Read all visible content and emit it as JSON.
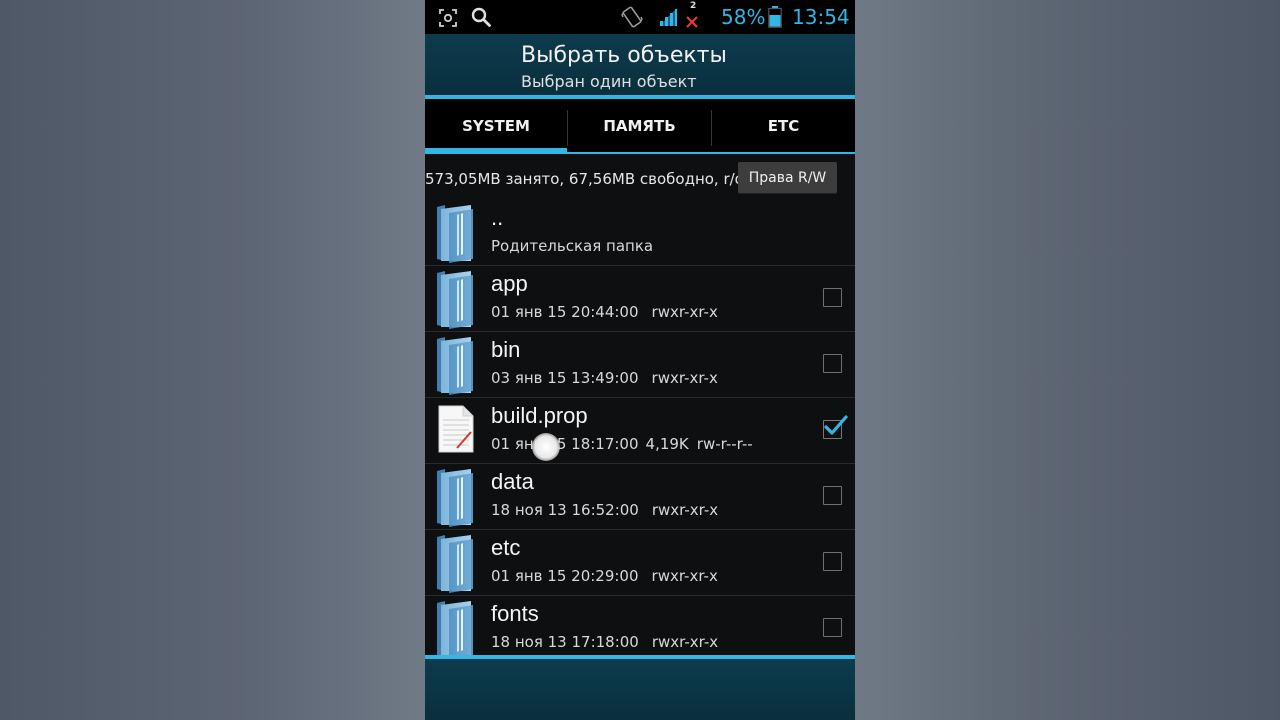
{
  "status_bar": {
    "battery": "58%",
    "time": "13:54",
    "sim_badge": "2",
    "icons": [
      "screenshot-icon",
      "search-icon",
      "vibrate-icon",
      "signal-icon",
      "no-signal-icon",
      "battery-icon"
    ],
    "accent_color": "#33b5e5"
  },
  "action_bar": {
    "title": "Выбрать объекты",
    "subtitle": "Выбран один объект"
  },
  "tabs": [
    {
      "label": "SYSTEM",
      "active": true
    },
    {
      "label": "ПАМЯТЬ",
      "active": false
    },
    {
      "label": "ETC",
      "active": false
    }
  ],
  "storage": {
    "info": "573,05MB занято, 67,56MB свободно, r/o",
    "rw_button": "Права R/W"
  },
  "files": [
    {
      "name": "..",
      "info": "Родительская папка",
      "type": "folder"
    },
    {
      "name": "app",
      "date": "01 янв 15 20:44:00",
      "size": "",
      "perms": "rwxr-xr-x",
      "type": "folder",
      "checked": false
    },
    {
      "name": "bin",
      "date": "03 янв 15 13:49:00",
      "size": "",
      "perms": "rwxr-xr-x",
      "type": "folder",
      "checked": false
    },
    {
      "name": "build.prop",
      "date": "01 янв 15 18:17:00",
      "size": "4,19K",
      "perms": "rw-r--r--",
      "type": "file",
      "checked": true
    },
    {
      "name": "data",
      "date": "18 ноя 13 16:52:00",
      "size": "",
      "perms": "rwxr-xr-x",
      "type": "folder",
      "checked": false
    },
    {
      "name": "etc",
      "date": "01 янв 15 20:29:00",
      "size": "",
      "perms": "rwxr-xr-x",
      "type": "folder",
      "checked": false
    },
    {
      "name": "fonts",
      "date": "18 ноя 13 17:18:00",
      "size": "",
      "perms": "rwxr-xr-x",
      "type": "folder",
      "checked": false
    }
  ]
}
